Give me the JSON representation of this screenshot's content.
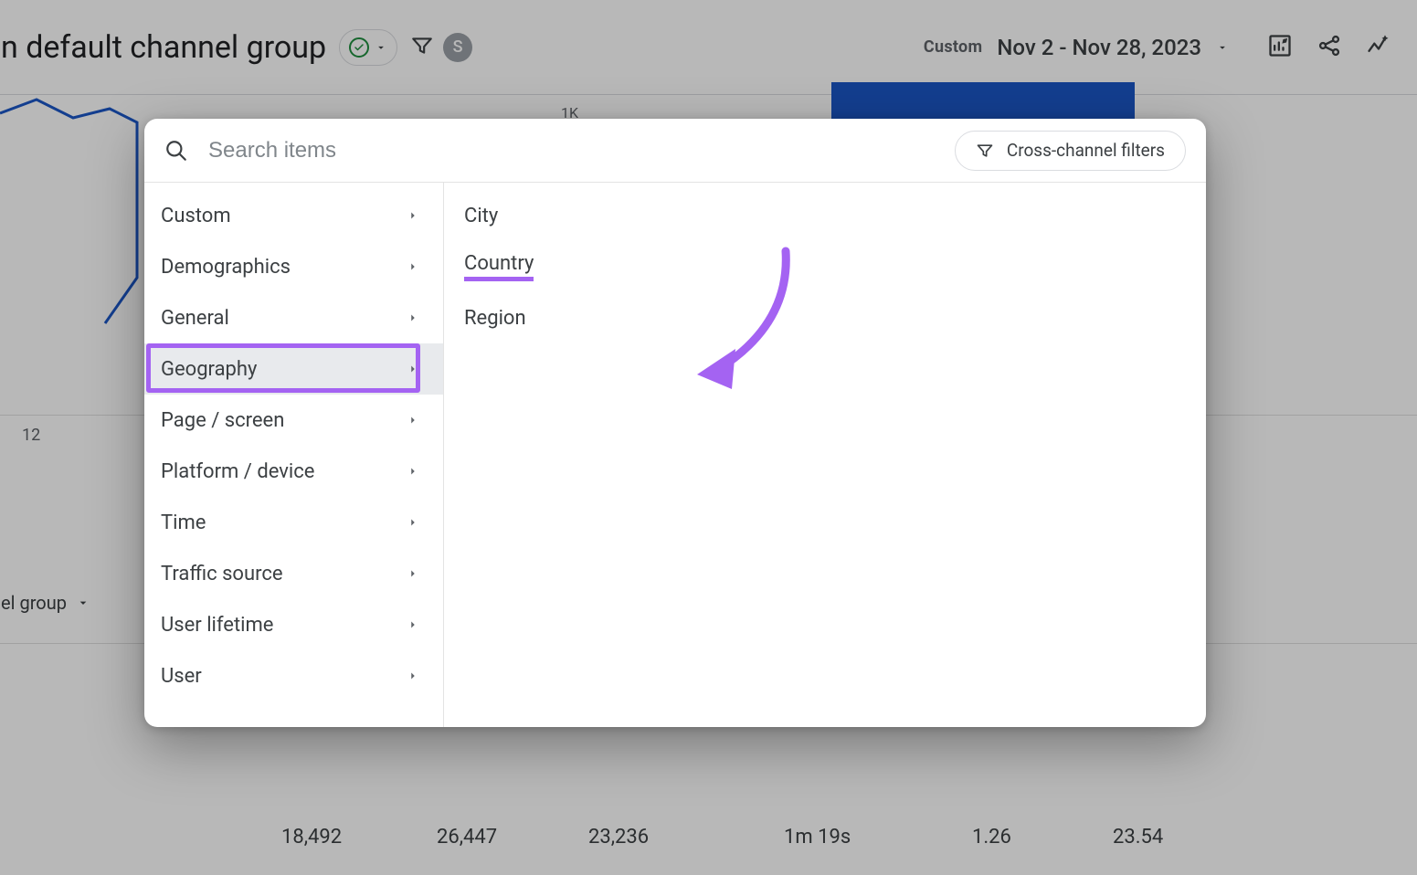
{
  "header": {
    "page_title": "sition: Session default channel group",
    "avatar_initial": "S",
    "date_label": "Custom",
    "date_range": "Nov 2 - Nov 28, 2023"
  },
  "chart_bg": {
    "axis_1k": "1K",
    "axis_12": "12",
    "dropdown_label": "nel group"
  },
  "row_values": {
    "v1": "18,492",
    "v2": "26,447",
    "v3": "23,236",
    "v4": "1m 19s",
    "v5": "1.26",
    "v6": "23.54"
  },
  "modal": {
    "search_placeholder": "Search items",
    "ccf_label": "Cross-channel filters",
    "categories": [
      {
        "label": "Custom"
      },
      {
        "label": "Demographics"
      },
      {
        "label": "General"
      },
      {
        "label": "Geography",
        "selected": true
      },
      {
        "label": "Page / screen"
      },
      {
        "label": "Platform / device"
      },
      {
        "label": "Time"
      },
      {
        "label": "Traffic source"
      },
      {
        "label": "User lifetime"
      },
      {
        "label": "User"
      }
    ],
    "sub_items": [
      {
        "label": "City"
      },
      {
        "label": "Country",
        "highlighted": true
      },
      {
        "label": "Region"
      }
    ]
  },
  "colors": {
    "purple": "#a463f2",
    "blue": "#1a56c6",
    "green": "#1e8e3e"
  }
}
